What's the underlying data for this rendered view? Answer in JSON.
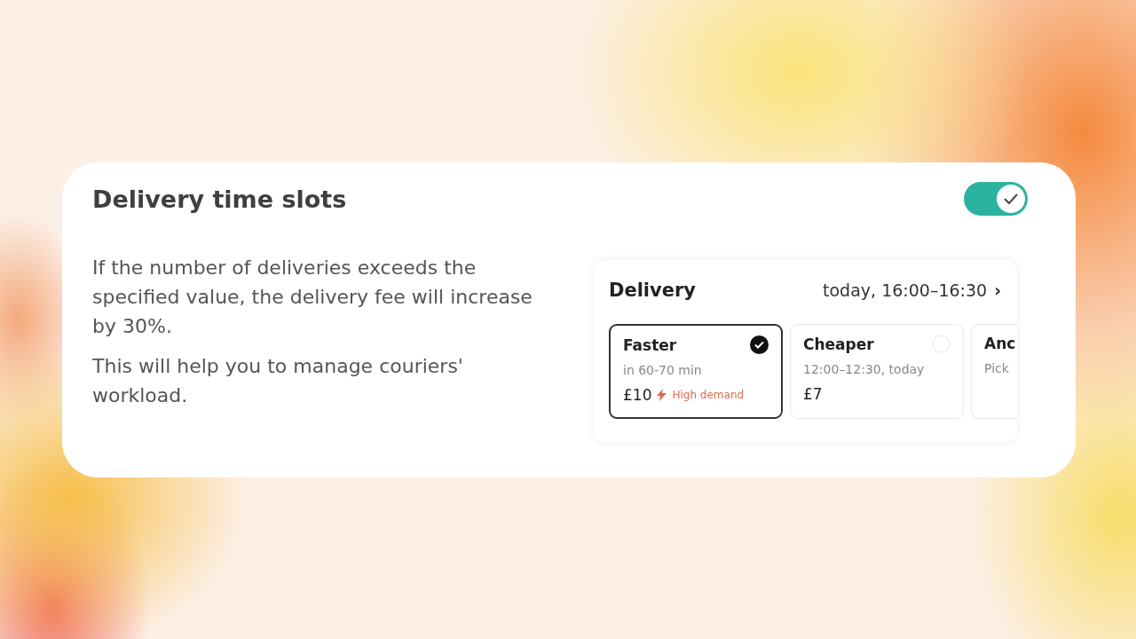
{
  "settings_card": {
    "title": "Delivery time slots",
    "toggle": {
      "on": true
    },
    "description": [
      "If the number of deliveries exceeds the specified value, the delivery fee will increase by 30%.",
      "This will help you to manage couriers' workload."
    ],
    "delivery_preview": {
      "title": "Delivery",
      "time": "today, 16:00–16:30",
      "chevron": "›",
      "options": [
        {
          "title": "Faster",
          "subtitle": "in 60-70 min",
          "price": "£10",
          "tag": "High demand",
          "selected": true
        },
        {
          "title": "Cheaper",
          "subtitle": "12:00–12:30, today",
          "price": "£7",
          "selected": false
        },
        {
          "title": "Anc",
          "subtitle": "Pick",
          "selected": false
        }
      ]
    }
  }
}
